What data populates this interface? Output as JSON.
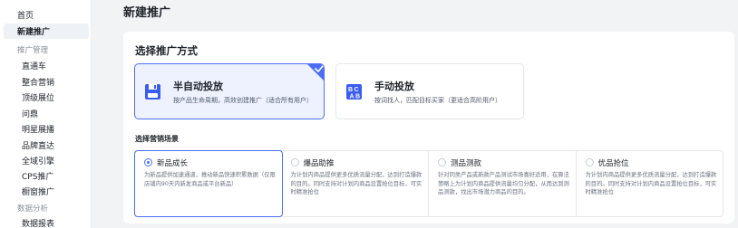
{
  "sidebar": {
    "items": [
      {
        "label": "首页",
        "type": "item"
      },
      {
        "label": "新建推广",
        "type": "active"
      },
      {
        "label": "推广管理",
        "type": "group"
      },
      {
        "label": "直通车",
        "type": "sub"
      },
      {
        "label": "整合营销",
        "type": "sub"
      },
      {
        "label": "顶级展位",
        "type": "sub"
      },
      {
        "label": "问鼎",
        "type": "sub"
      },
      {
        "label": "明星展播",
        "type": "sub"
      },
      {
        "label": "品牌直达",
        "type": "sub"
      },
      {
        "label": "全域引擎",
        "type": "sub"
      },
      {
        "label": "CPS推广",
        "type": "sub"
      },
      {
        "label": "橱窗推广",
        "type": "sub"
      },
      {
        "label": "数据分析",
        "type": "group"
      },
      {
        "label": "数据报表",
        "type": "sub"
      }
    ]
  },
  "page": {
    "title": "新建推广",
    "section_title": "选择推广方式",
    "scene_title": "选择营销场景"
  },
  "modes": [
    {
      "name": "半自动投放",
      "desc": "按产品生命周期，高效创建推广（适合所有用户）",
      "selected": true,
      "icon": "save-box-icon"
    },
    {
      "name": "手动投放",
      "desc": "按词找人，匹配目标买家（更适合高阶用户）",
      "selected": false,
      "icon": "abc-icon"
    }
  ],
  "scenes": [
    {
      "name": "新品成长",
      "desc": "为新品提供加速通道，推动新品快速积累数据（仅限店铺内90天内新发商品或平台新品）",
      "selected": true
    },
    {
      "name": "爆品助推",
      "desc": "为计划内商品提供更多优质流量分配，达到打造爆款的目的。同时支持对计划内商品设置抢位目标，可实时精准抢位",
      "selected": false
    },
    {
      "name": "测品测款",
      "desc": "针对同类产品或新款产品测试市场喜好适用，在算法策略上为计划内商品提供流量均匀分配，从而达到测品测款，找出市场潜力商品的目的。",
      "selected": false
    },
    {
      "name": "优品抢位",
      "desc": "为计划内商品提供更多优质流量分配，达到打造爆款的目的。同时支持对计划内商品设置抢位目标，可实时精准抢位",
      "selected": false
    }
  ],
  "colors": {
    "accent": "#4d6ef5",
    "selected_bg": "#eef2ff"
  }
}
